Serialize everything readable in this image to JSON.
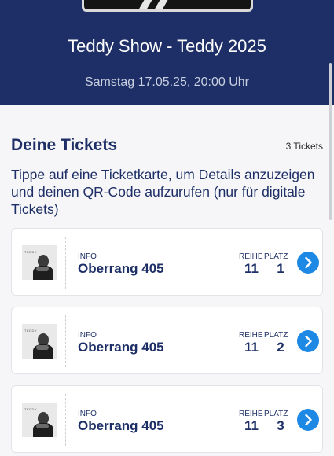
{
  "event": {
    "title": "Teddy Show - Teddy 2025",
    "date": "Samstag 17.05.25, 20:00 Uhr"
  },
  "tickets_section": {
    "title": "Deine Tickets",
    "count": "3 Tickets",
    "instructions": "Tippe auf eine Ticketkarte, um Details anzuzeigen und deinen QR-Code aufzurufen (nur für digitale Tickets)"
  },
  "tickets": [
    {
      "info_label": "INFO",
      "info_value": "Oberrang 405",
      "row_label": "REIHE",
      "row": "11",
      "seat_label": "PLATZ",
      "seat": "1"
    },
    {
      "info_label": "INFO",
      "info_value": "Oberrang 405",
      "row_label": "REIHE",
      "row": "11",
      "seat_label": "PLATZ",
      "seat": "2"
    },
    {
      "info_label": "INFO",
      "info_value": "Oberrang 405",
      "row_label": "REIHE",
      "row": "11",
      "seat_label": "PLATZ",
      "seat": "3"
    }
  ],
  "colors": {
    "header_bg": "#1d2f66",
    "text_primary": "#1d2f66",
    "accent": "#1e88e5"
  },
  "icons": {
    "ticket_action": "chevron-right-icon",
    "ticket_thumbnail": "artist-photo"
  }
}
